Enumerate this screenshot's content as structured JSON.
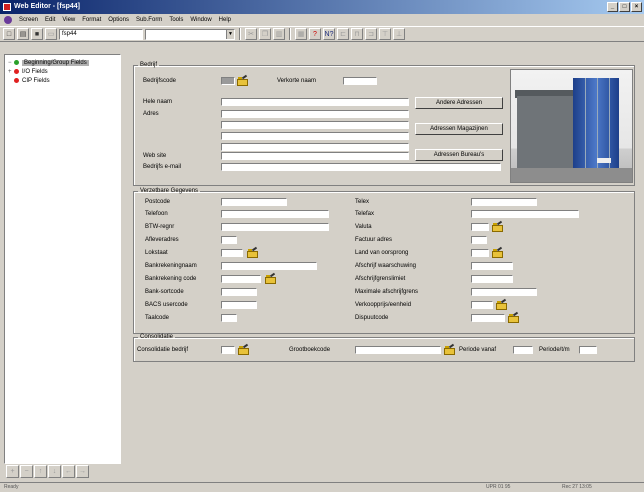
{
  "window": {
    "title": "Web Editor - [fsp44]"
  },
  "menu": [
    "Screen",
    "Edit",
    "View",
    "Format",
    "Options",
    "Sub.Form",
    "Tools",
    "Window",
    "Help"
  ],
  "toolbar": {
    "form_select": "fsp44"
  },
  "tree": {
    "items": [
      {
        "label": "Beginning/Group Fields",
        "color": "#2aa02a",
        "selected": true
      },
      {
        "label": "I/O Fields",
        "color": "#e02020",
        "selected": false
      },
      {
        "label": "CIP Fields",
        "color": "#e02020",
        "selected": false
      }
    ]
  },
  "bedrijf": {
    "legend": "Bedrijf",
    "bedrijfscode": "Bedrijfscode",
    "verkorte_naam": "Verkorte naam",
    "hele_naam": "Hele naam",
    "adres": "Adres",
    "web_site": "Web site",
    "email": "Bedrijfs e-mail",
    "btn_andere": "Andere Adressen",
    "btn_magazijnen": "Adressen Magazijnen",
    "btn_bureaus": "Adressen Bureau's"
  },
  "gegevens": {
    "legend": "Verzetbare Gegevens",
    "left": [
      "Postcode",
      "Telefoon",
      "BTW-regnr",
      "Afleveradres",
      "Lokstaat",
      "Bankrekeningnaam",
      "Bankrekening code",
      "Bank-sortcode",
      "BACS usercode",
      "Taalcode"
    ],
    "right": [
      "Telex",
      "Telefax",
      "Valuta",
      "Factuur adres",
      "Land van oorsprong",
      "Afschrijf waarschuwing",
      "Afschrijfgrenslimiet",
      "Maximale afschrijfgrens",
      "Verkoopprijs/eenheid",
      "Dispuutcode"
    ]
  },
  "consolidatie": {
    "legend": "Consolidatie",
    "bedrijf": "Consolidatie bedrijf",
    "grootboekcode": "Grootboekcode",
    "periode_vanaf": "Periode vanaf",
    "periode_tm": "Periode/t/m"
  },
  "status": {
    "left": "Ready",
    "mid": "UPR 01 95",
    "right": "Rec 27 13:05"
  }
}
